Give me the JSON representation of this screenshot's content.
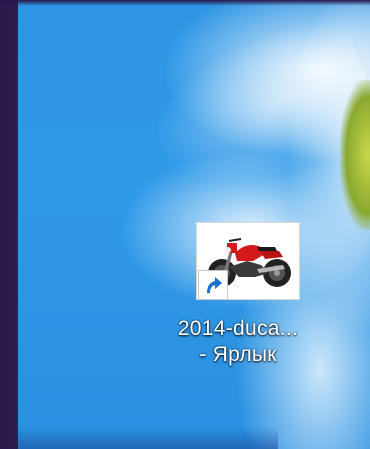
{
  "desktop": {
    "shortcut": {
      "label_line1": "2014-duca...",
      "label_line2": "- Ярлык",
      "thumbnail_icon": "motorcycle-thumbnail-icon",
      "overlay_icon": "shortcut-arrow-icon"
    }
  },
  "colors": {
    "wallpaper_blue": "#2f9ae8",
    "left_bar": "#2a174b",
    "motorcycle_red": "#d21a1a"
  }
}
